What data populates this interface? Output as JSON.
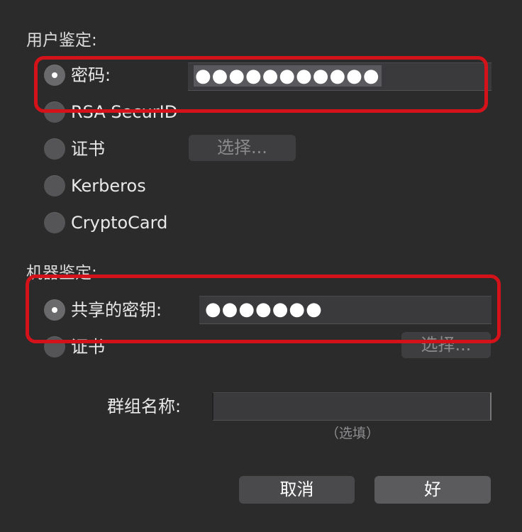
{
  "user_auth": {
    "title": "用户鉴定:",
    "options": [
      {
        "label": "密码:",
        "selected": true
      },
      {
        "label": "RSA SecurID",
        "selected": false
      },
      {
        "label": "证书",
        "selected": false
      },
      {
        "label": "Kerberos",
        "selected": false
      },
      {
        "label": "CryptoCard",
        "selected": false
      }
    ],
    "password_value": "●●●●●●●●●●●",
    "choose_label": "选择..."
  },
  "machine_auth": {
    "title": "机器鉴定:",
    "options": [
      {
        "label": "共享的密钥:",
        "selected": true
      },
      {
        "label": "证书",
        "selected": false
      }
    ],
    "shared_secret_value": "●●●●●●●",
    "choose_label": "选择..."
  },
  "group": {
    "label": "群组名称:",
    "value": "",
    "hint": "（选填）"
  },
  "buttons": {
    "cancel": "取消",
    "ok": "好"
  },
  "colors": {
    "background": "#2b2b2c",
    "highlight": "#d4121a"
  }
}
